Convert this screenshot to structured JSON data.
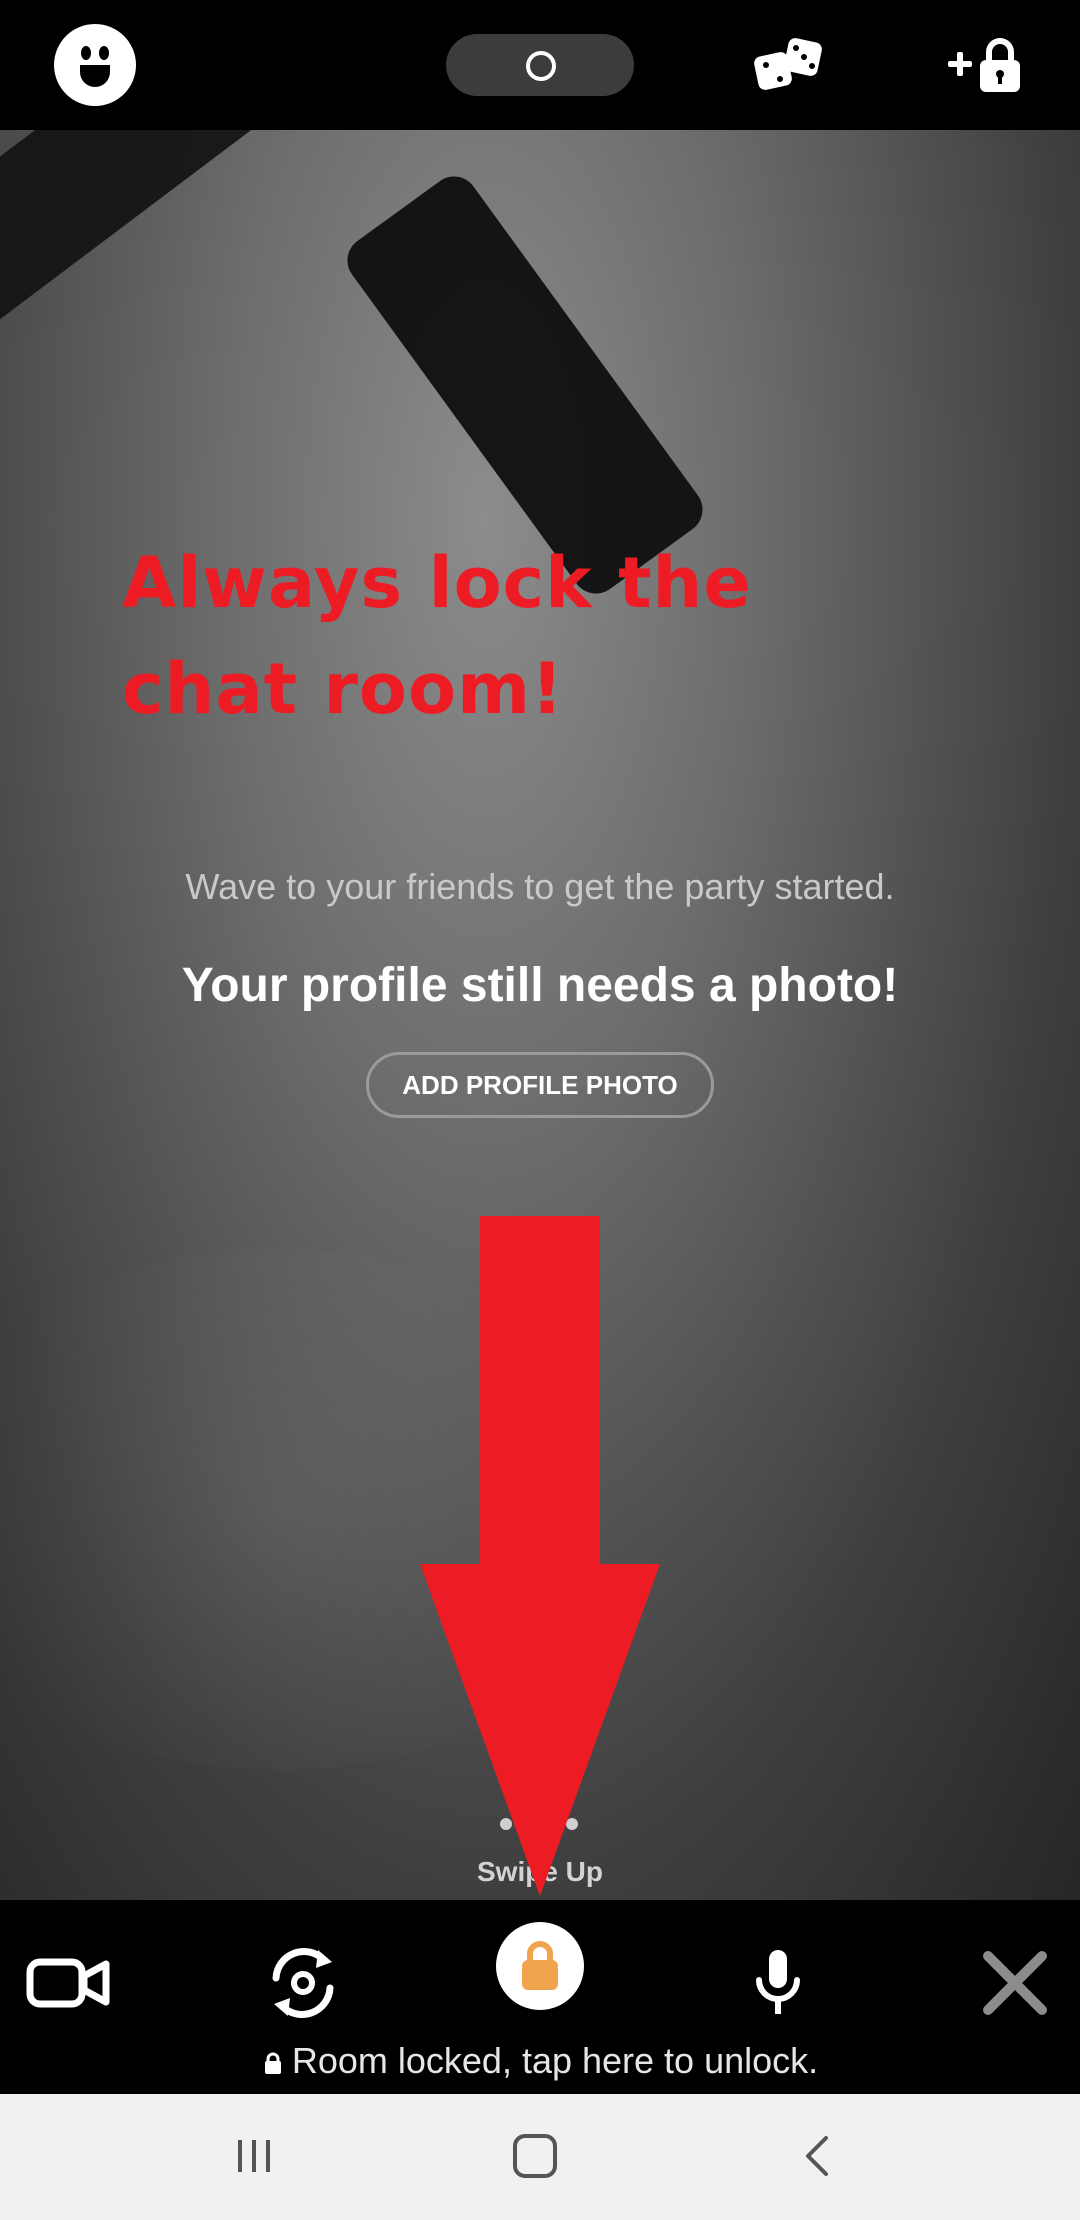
{
  "annotation": {
    "line1": "Always lock the",
    "line2": "chat room!"
  },
  "main": {
    "wave_text": "Wave to your friends to get the party started.",
    "profile_text": "Your profile still needs a photo!",
    "add_photo_label": "ADD PROFILE PHOTO"
  },
  "swipe": {
    "label": "Swipe Up"
  },
  "bottom": {
    "lock_status": "Room locked, tap here to unlock."
  },
  "icons": {
    "top": [
      "app-logo-icon",
      "status-ring-icon",
      "dice-icon",
      "add-lock-icon"
    ],
    "bottom": [
      "video-camera-icon",
      "switch-camera-icon",
      "lock-icon",
      "microphone-icon",
      "close-icon"
    ],
    "nav": [
      "recent-apps-icon",
      "home-icon",
      "back-icon"
    ]
  },
  "colors": {
    "annotation_red": "#ed1c24",
    "lock_orange": "#f0a44e",
    "background": "#000000"
  }
}
